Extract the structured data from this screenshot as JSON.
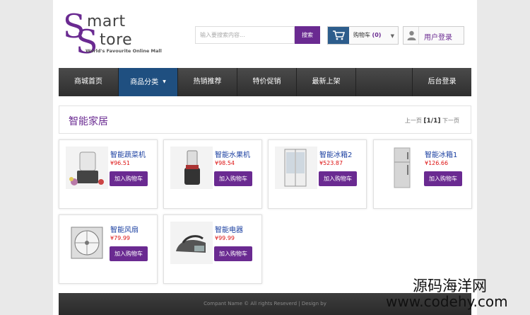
{
  "logo": {
    "letter1": "S",
    "word1": "mart",
    "letter2": "S",
    "word2": "tore",
    "tagline": "World's Favourite Online Mall"
  },
  "search": {
    "placeholder": "输入要搜索内容...",
    "button": "搜索"
  },
  "cart": {
    "label": "购物车",
    "count": "(0)",
    "icon": "cart-icon"
  },
  "login": {
    "label": "用户登录",
    "icon": "user-icon"
  },
  "nav": {
    "items": [
      {
        "label": "商城首页"
      },
      {
        "label": "商品分类"
      },
      {
        "label": "热销推荐"
      },
      {
        "label": "特价促销"
      },
      {
        "label": "最新上架"
      },
      {
        "label": "后台登录"
      }
    ],
    "active_index": 1
  },
  "category": {
    "title": "智能家居",
    "pager": {
      "prev": "上一页",
      "current": "[1/1]",
      "next": "下一页"
    }
  },
  "products": [
    {
      "name": "智能蔬菜机",
      "price": "¥96.51",
      "button": "加入购物车"
    },
    {
      "name": "智能水果机",
      "price": "¥98.54",
      "button": "加入购物车"
    },
    {
      "name": "智能冰箱2",
      "price": "¥523.87",
      "button": "加入购物车"
    },
    {
      "name": "智能冰箱1",
      "price": "¥126.66",
      "button": "加入购物车"
    },
    {
      "name": "智能风扇",
      "price": "¥79.99",
      "button": "加入购物车"
    },
    {
      "name": "智能电器",
      "price": "¥99.99",
      "button": "加入购物车"
    }
  ],
  "footer": {
    "text": "Compant Name © All rights Reseverd | Design by"
  },
  "watermark": {
    "line1": "源码海洋网",
    "line2": "www.codehy.com"
  },
  "colors": {
    "brand": "#6a2a91",
    "nav_active": "#1f4f80",
    "price": "#dd1111",
    "product_name": "#1a3fa0"
  }
}
